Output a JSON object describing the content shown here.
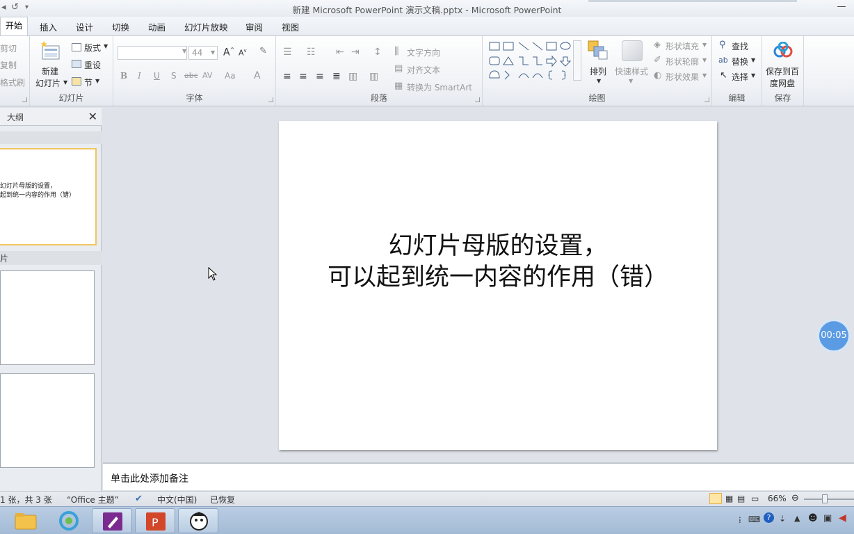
{
  "window": {
    "title": "新建 Microsoft PowerPoint 演示文稿.pptx - Microsoft PowerPoint"
  },
  "ribbon_tabs": [
    "开始",
    "插入",
    "设计",
    "切换",
    "动画",
    "幻灯片放映",
    "审阅",
    "视图"
  ],
  "clipboard": {
    "cut": "剪切",
    "copy": "复制",
    "format_painter": "格式刷"
  },
  "slides_group": {
    "label": "幻灯片",
    "new_slide_line1": "新建",
    "new_slide_line2": "幻灯片",
    "layout": "版式",
    "reset": "重设",
    "section": "节"
  },
  "font_group": {
    "label": "字体",
    "font_name": "",
    "font_size": "44",
    "bold": "B",
    "italic": "I",
    "underline": "U",
    "shadow": "S",
    "strike": "abc",
    "spacing": "AV",
    "case": "Aa",
    "color": "A"
  },
  "paragraph_group": {
    "label": "段落",
    "text_direction": "文字方向",
    "align_text": "对齐文本",
    "smartart": "转换为 SmartArt"
  },
  "drawing_group": {
    "label": "绘图",
    "arrange": "排列",
    "quick_styles": "快速样式",
    "shape_fill": "形状填充",
    "shape_outline": "形状轮廓",
    "shape_effects": "形状效果"
  },
  "editing_group": {
    "label": "编辑",
    "find": "查找",
    "replace": "替换",
    "select": "选择"
  },
  "save_group": {
    "label": "保存",
    "save_line1": "保存到百",
    "save_line2": "度网盘"
  },
  "left_pane": {
    "tab_outline": "大纲",
    "slides_label": "片",
    "thumb1_line1": "幻灯片母版的设置，",
    "thumb1_line2": "起到统一内容的作用（错）"
  },
  "slide": {
    "line1": "幻灯片母版的设置，",
    "line2": "可以起到统一内容的作用（错）"
  },
  "notes": {
    "placeholder": "单击此处添加备注"
  },
  "status": {
    "slide_info": "1 张，共 3 张",
    "theme": "“Office 主题”",
    "language": "中文(中国)",
    "recovered": "已恢复",
    "zoom": "66%"
  },
  "timer": {
    "value": "00:05"
  },
  "colors": {
    "accent": "#f2c660",
    "timer": "#5b9be3"
  }
}
